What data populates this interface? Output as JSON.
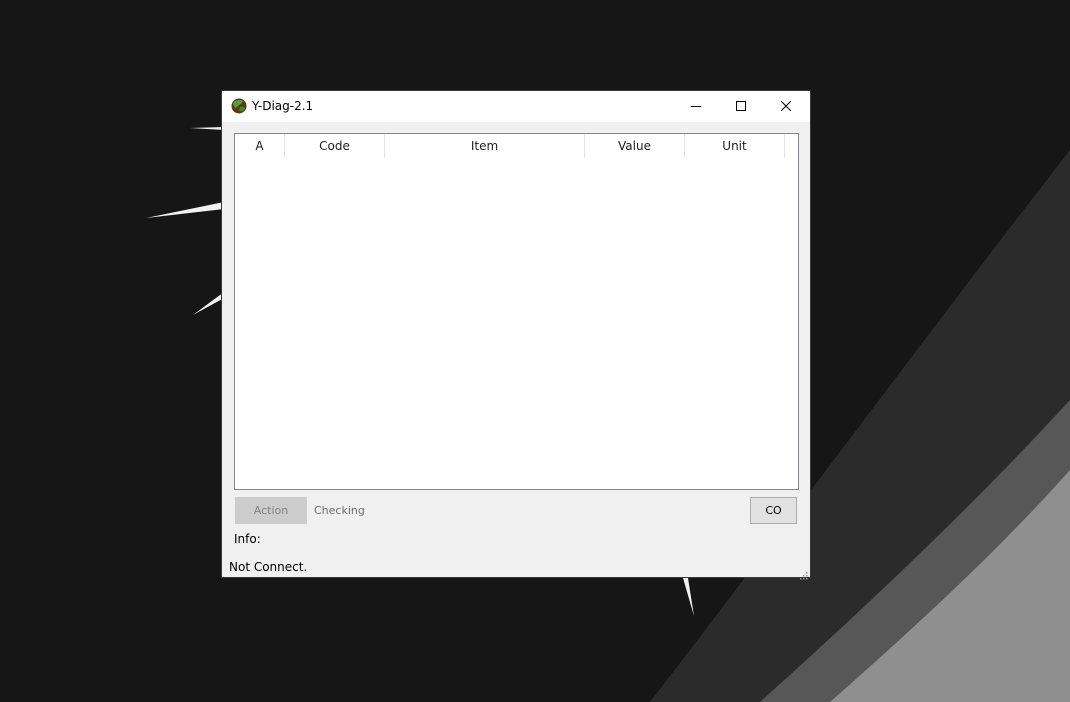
{
  "window": {
    "title": "Y-Diag-2.1",
    "icon": "globe-icon"
  },
  "title_buttons": [
    "minimize-icon",
    "maximize-icon",
    "close-icon"
  ],
  "grid": {
    "columns": [
      "A",
      "Code",
      "Item",
      "Value",
      "Unit"
    ],
    "rows": []
  },
  "controls": {
    "action_label": "Action",
    "checking_label": "Checking",
    "co_label": "CO",
    "info_label": "Info:"
  },
  "status": {
    "text": "Not Connect."
  },
  "colors": {
    "desktop_bg": "#161616",
    "window_bg": "#f0f0f0",
    "titlebar_bg": "#ffffff",
    "disabled_button_bg": "#cccccc",
    "grid_border": "#828790"
  }
}
